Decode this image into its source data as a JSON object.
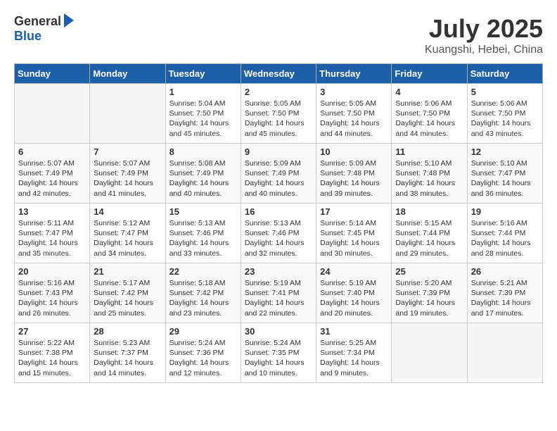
{
  "header": {
    "logo_general": "General",
    "logo_blue": "Blue",
    "month": "July 2025",
    "location": "Kuangshi, Hebei, China"
  },
  "days_of_week": [
    "Sunday",
    "Monday",
    "Tuesday",
    "Wednesday",
    "Thursday",
    "Friday",
    "Saturday"
  ],
  "weeks": [
    [
      {
        "day": "",
        "empty": true,
        "content": ""
      },
      {
        "day": "",
        "empty": true,
        "content": ""
      },
      {
        "day": "1",
        "empty": false,
        "content": "Sunrise: 5:04 AM\nSunset: 7:50 PM\nDaylight: 14 hours\nand 45 minutes."
      },
      {
        "day": "2",
        "empty": false,
        "content": "Sunrise: 5:05 AM\nSunset: 7:50 PM\nDaylight: 14 hours\nand 45 minutes."
      },
      {
        "day": "3",
        "empty": false,
        "content": "Sunrise: 5:05 AM\nSunset: 7:50 PM\nDaylight: 14 hours\nand 44 minutes."
      },
      {
        "day": "4",
        "empty": false,
        "content": "Sunrise: 5:06 AM\nSunset: 7:50 PM\nDaylight: 14 hours\nand 44 minutes."
      },
      {
        "day": "5",
        "empty": false,
        "content": "Sunrise: 5:06 AM\nSunset: 7:50 PM\nDaylight: 14 hours\nand 43 minutes."
      }
    ],
    [
      {
        "day": "6",
        "empty": false,
        "content": "Sunrise: 5:07 AM\nSunset: 7:49 PM\nDaylight: 14 hours\nand 42 minutes."
      },
      {
        "day": "7",
        "empty": false,
        "content": "Sunrise: 5:07 AM\nSunset: 7:49 PM\nDaylight: 14 hours\nand 41 minutes."
      },
      {
        "day": "8",
        "empty": false,
        "content": "Sunrise: 5:08 AM\nSunset: 7:49 PM\nDaylight: 14 hours\nand 40 minutes."
      },
      {
        "day": "9",
        "empty": false,
        "content": "Sunrise: 5:09 AM\nSunset: 7:49 PM\nDaylight: 14 hours\nand 40 minutes."
      },
      {
        "day": "10",
        "empty": false,
        "content": "Sunrise: 5:09 AM\nSunset: 7:48 PM\nDaylight: 14 hours\nand 39 minutes."
      },
      {
        "day": "11",
        "empty": false,
        "content": "Sunrise: 5:10 AM\nSunset: 7:48 PM\nDaylight: 14 hours\nand 38 minutes."
      },
      {
        "day": "12",
        "empty": false,
        "content": "Sunrise: 5:10 AM\nSunset: 7:47 PM\nDaylight: 14 hours\nand 36 minutes."
      }
    ],
    [
      {
        "day": "13",
        "empty": false,
        "content": "Sunrise: 5:11 AM\nSunset: 7:47 PM\nDaylight: 14 hours\nand 35 minutes."
      },
      {
        "day": "14",
        "empty": false,
        "content": "Sunrise: 5:12 AM\nSunset: 7:47 PM\nDaylight: 14 hours\nand 34 minutes."
      },
      {
        "day": "15",
        "empty": false,
        "content": "Sunrise: 5:13 AM\nSunset: 7:46 PM\nDaylight: 14 hours\nand 33 minutes."
      },
      {
        "day": "16",
        "empty": false,
        "content": "Sunrise: 5:13 AM\nSunset: 7:46 PM\nDaylight: 14 hours\nand 32 minutes."
      },
      {
        "day": "17",
        "empty": false,
        "content": "Sunrise: 5:14 AM\nSunset: 7:45 PM\nDaylight: 14 hours\nand 30 minutes."
      },
      {
        "day": "18",
        "empty": false,
        "content": "Sunrise: 5:15 AM\nSunset: 7:44 PM\nDaylight: 14 hours\nand 29 minutes."
      },
      {
        "day": "19",
        "empty": false,
        "content": "Sunrise: 5:16 AM\nSunset: 7:44 PM\nDaylight: 14 hours\nand 28 minutes."
      }
    ],
    [
      {
        "day": "20",
        "empty": false,
        "content": "Sunrise: 5:16 AM\nSunset: 7:43 PM\nDaylight: 14 hours\nand 26 minutes."
      },
      {
        "day": "21",
        "empty": false,
        "content": "Sunrise: 5:17 AM\nSunset: 7:42 PM\nDaylight: 14 hours\nand 25 minutes."
      },
      {
        "day": "22",
        "empty": false,
        "content": "Sunrise: 5:18 AM\nSunset: 7:42 PM\nDaylight: 14 hours\nand 23 minutes."
      },
      {
        "day": "23",
        "empty": false,
        "content": "Sunrise: 5:19 AM\nSunset: 7:41 PM\nDaylight: 14 hours\nand 22 minutes."
      },
      {
        "day": "24",
        "empty": false,
        "content": "Sunrise: 5:19 AM\nSunset: 7:40 PM\nDaylight: 14 hours\nand 20 minutes."
      },
      {
        "day": "25",
        "empty": false,
        "content": "Sunrise: 5:20 AM\nSunset: 7:39 PM\nDaylight: 14 hours\nand 19 minutes."
      },
      {
        "day": "26",
        "empty": false,
        "content": "Sunrise: 5:21 AM\nSunset: 7:39 PM\nDaylight: 14 hours\nand 17 minutes."
      }
    ],
    [
      {
        "day": "27",
        "empty": false,
        "content": "Sunrise: 5:22 AM\nSunset: 7:38 PM\nDaylight: 14 hours\nand 15 minutes."
      },
      {
        "day": "28",
        "empty": false,
        "content": "Sunrise: 5:23 AM\nSunset: 7:37 PM\nDaylight: 14 hours\nand 14 minutes."
      },
      {
        "day": "29",
        "empty": false,
        "content": "Sunrise: 5:24 AM\nSunset: 7:36 PM\nDaylight: 14 hours\nand 12 minutes."
      },
      {
        "day": "30",
        "empty": false,
        "content": "Sunrise: 5:24 AM\nSunset: 7:35 PM\nDaylight: 14 hours\nand 10 minutes."
      },
      {
        "day": "31",
        "empty": false,
        "content": "Sunrise: 5:25 AM\nSunset: 7:34 PM\nDaylight: 14 hours\nand 9 minutes."
      },
      {
        "day": "",
        "empty": true,
        "content": ""
      },
      {
        "day": "",
        "empty": true,
        "content": ""
      }
    ]
  ]
}
